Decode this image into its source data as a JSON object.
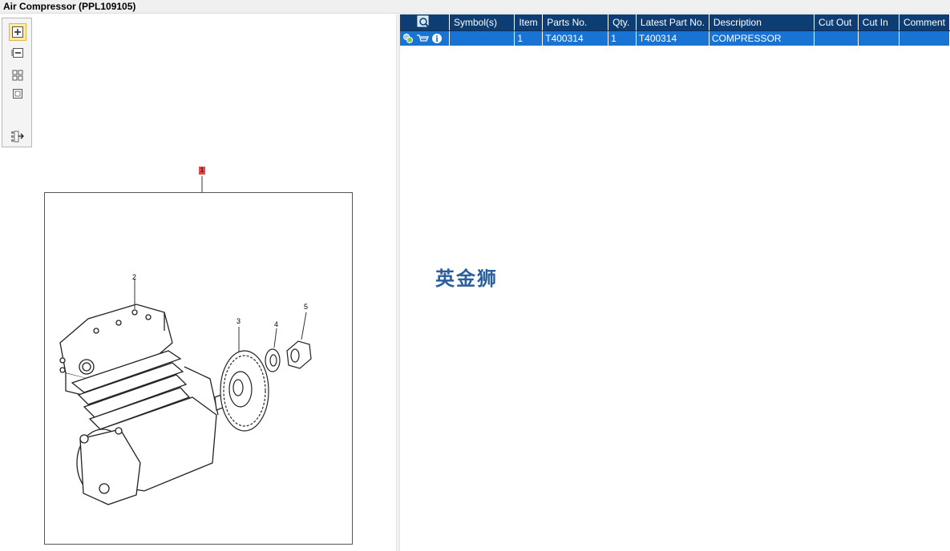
{
  "window": {
    "title": "Air Compressor (PPL109105)"
  },
  "toolbar": {
    "icons": [
      "zoom-in-icon",
      "zoom-out-icon",
      "fit-grid-icon",
      "single-view-icon",
      "export-list-icon"
    ]
  },
  "drawing": {
    "callouts": [
      "1",
      "2",
      "3",
      "4",
      "5"
    ]
  },
  "table": {
    "columns": [
      "Symbol(s)",
      "Item",
      "Parts No.",
      "Qty.",
      "Latest Part No.",
      "Description",
      "Cut Out",
      "Cut In",
      "Comment"
    ],
    "rows": [
      {
        "symbols": "",
        "item": "1",
        "parts_no": "T400314",
        "qty": "1",
        "latest_part_no": "T400314",
        "description": "COMPRESSOR",
        "cut_out": "",
        "cut_in": "",
        "comment": ""
      }
    ]
  },
  "watermark": {
    "text": "英金狮"
  },
  "colors": {
    "header": "#0e3d73",
    "selected_row": "#1873d3",
    "callout_marker": "#e8484a"
  }
}
